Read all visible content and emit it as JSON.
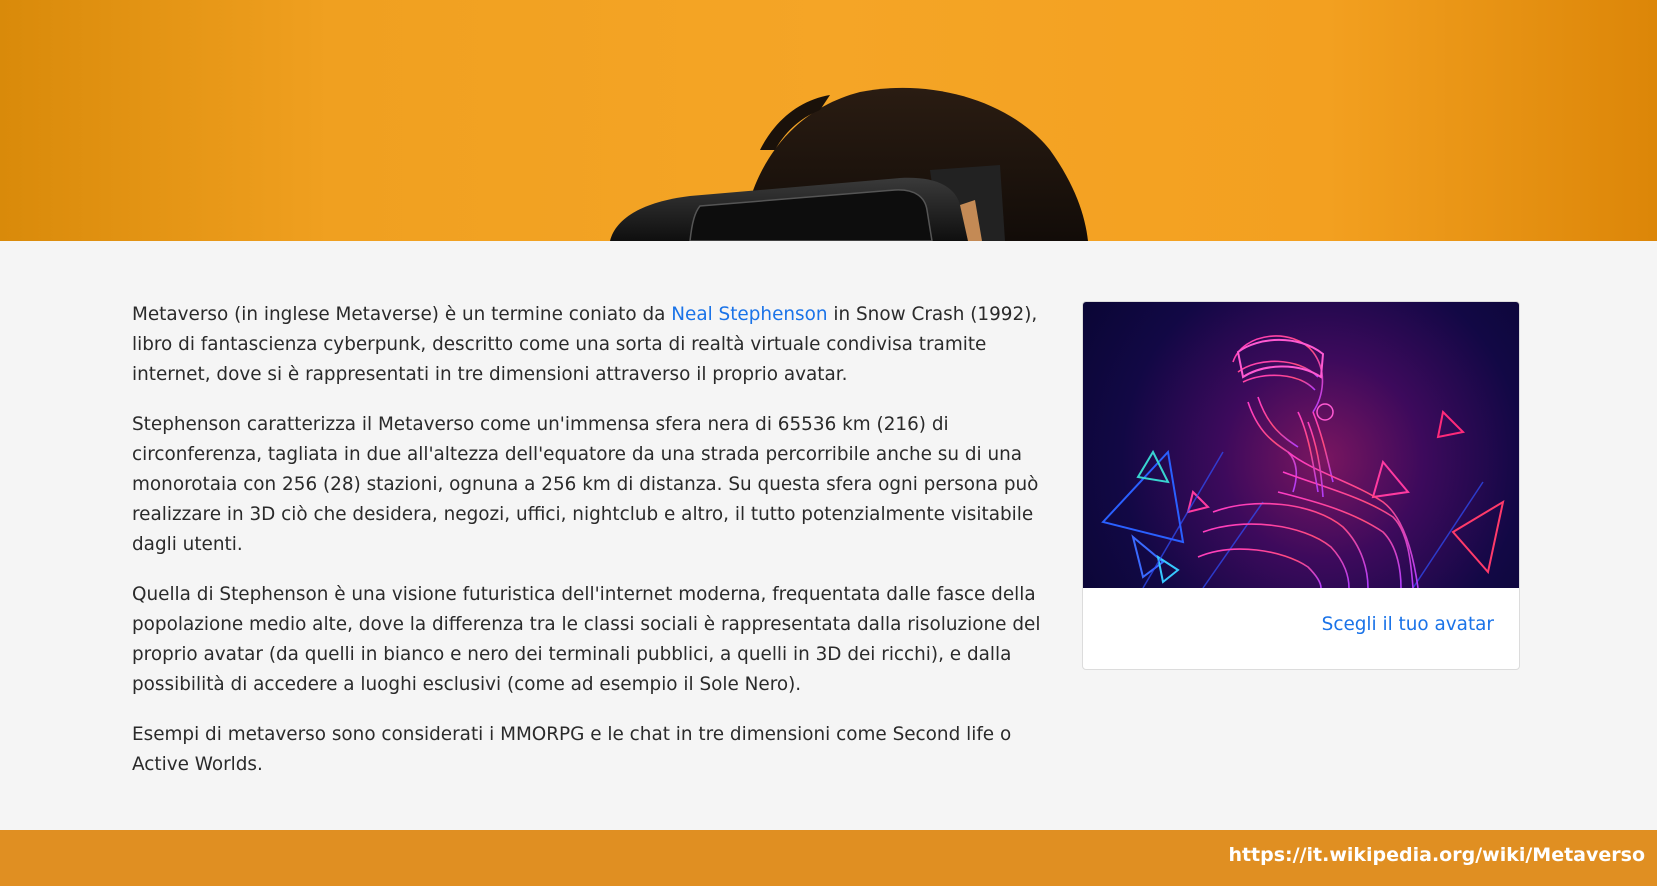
{
  "hero": {
    "image": "person-with-vr-headset-on-orange-background",
    "colors": {
      "background": "#f5a526",
      "hair": "#1a120c",
      "headset": "#1c1c1c"
    }
  },
  "article": {
    "p1_before": "Metaverso (in inglese Metaverse) è un termine coniato da ",
    "p1_link": "Neal Stephenson",
    "p1_after": " in Snow Crash (1992), libro di fantascienza cyberpunk, descritto come una sorta di realtà virtuale condivisa tramite internet, dove si è rappresentati in tre dimensioni attraverso il proprio avatar.",
    "p2": "Stephenson caratterizza il Metaverso come un'immensa sfera nera di 65536 km (216) di circonferenza, tagliata in due all'altezza dell'equatore da una strada percorribile anche su di una monorotaia con 256 (28) stazioni, ognuna a 256 km di distanza. Su questa sfera ogni persona può realizzare in 3D ciò che desidera, negozi, uffici, nightclub e altro, il tutto potenzialmente visitabile dagli utenti.",
    "p3": "Quella di Stephenson è una visione futuristica dell'internet moderna, frequentata dalle fasce della popolazione medio alte, dove la differenza tra le classi sociali è rappresentata dalla risoluzione del proprio avatar (da quelli in bianco e nero dei terminali pubblici, a quelli in 3D dei ricchi), e dalla possibilità di accedere a luoghi esclusivi (come ad esempio il Sole Nero).",
    "p4": "Esempi di metaverso sono considerati i MMORPG e le chat in tre dimensioni come Second life o Active Worlds."
  },
  "card": {
    "image": "neon-wireframe-person-wearing-vr-headset",
    "link_label": "Scegli il tuo avatar"
  },
  "footer": {
    "url": "https://it.wikipedia.org/wiki/Metaverso"
  },
  "colors": {
    "accent_orange": "#e08f22",
    "link_blue": "#1a73e8",
    "page_bg": "#f5f5f5"
  }
}
